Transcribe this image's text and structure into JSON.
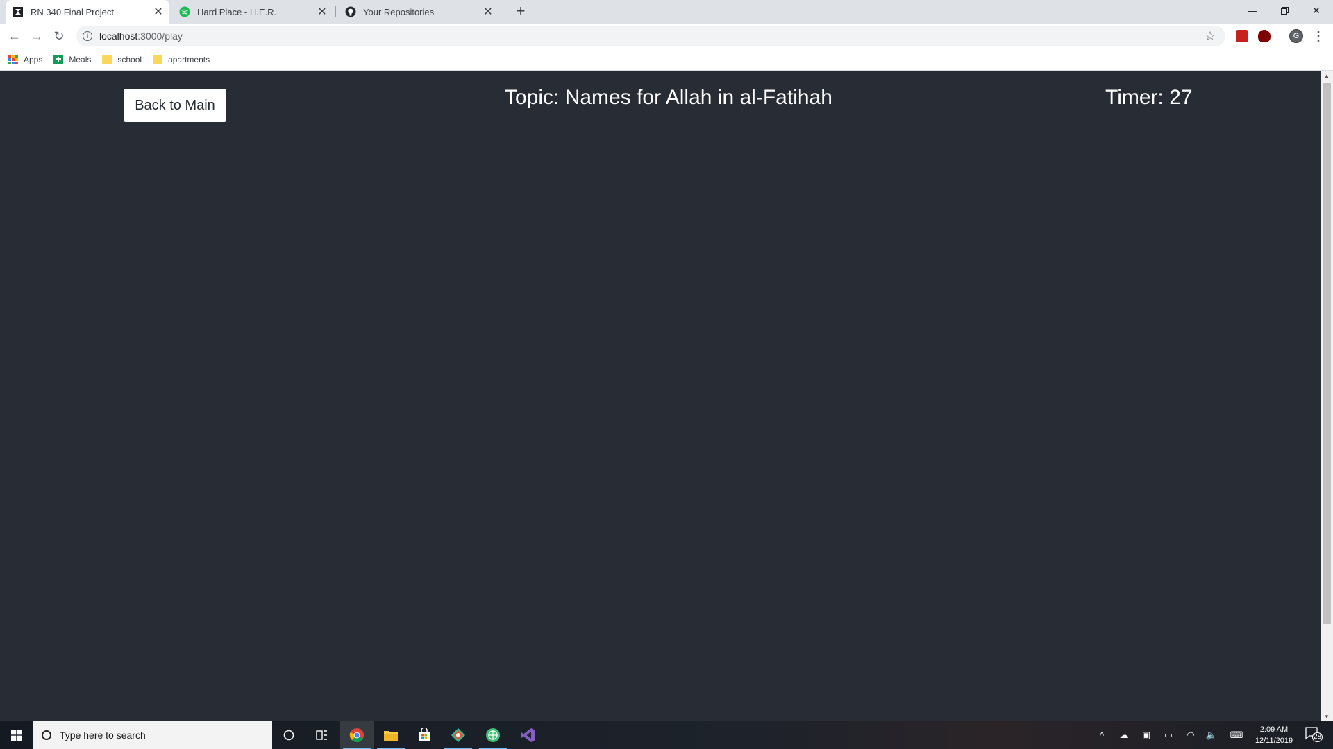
{
  "browser": {
    "tabs": [
      {
        "title": "RN 340 Final Project",
        "active": true
      },
      {
        "title": "Hard Place - H.E.R.",
        "active": false
      },
      {
        "title": "Your Repositories",
        "active": false
      }
    ],
    "url_host": "localhost",
    "url_path": ":3000/play",
    "profile_initial": "G",
    "bookmarks": [
      "Apps",
      "Meals",
      "school",
      "apartments"
    ]
  },
  "page": {
    "back_button_label": "Back to Main",
    "topic_text": "Topic: Names for Allah in al-Fatihah",
    "timer_text": "Timer: 27"
  },
  "taskbar": {
    "search_placeholder": "Type here to search",
    "time": "2:09 AM",
    "date": "12/11/2019",
    "notification_count": "28"
  },
  "colors": {
    "page_background": "#282c34",
    "tab_strip": "#dee1e6",
    "button_background": "#ffffff"
  }
}
